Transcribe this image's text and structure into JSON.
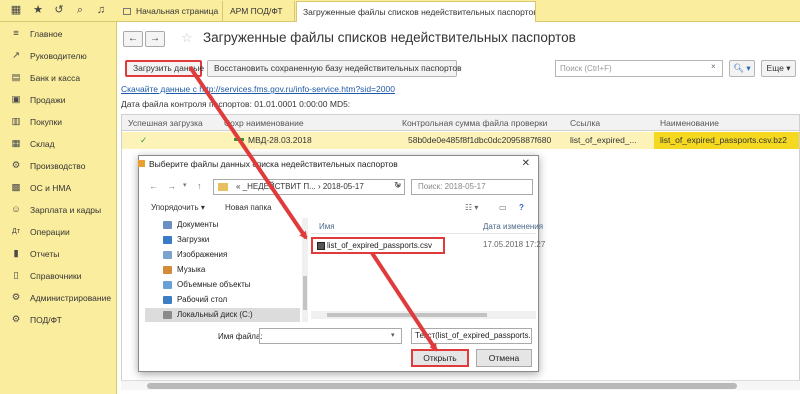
{
  "topbar": {
    "tabs": [
      {
        "label": "Начальная страница"
      },
      {
        "label": "АРМ ПОД/ФТ"
      },
      {
        "label": "Загруженные файлы списков недействительных паспортов",
        "close": "×"
      }
    ]
  },
  "sidebar": {
    "items": [
      {
        "label": "Главное",
        "icon": "menu-icon"
      },
      {
        "label": "Руководителю",
        "icon": "trend-icon"
      },
      {
        "label": "Банк и касса",
        "icon": "bank-icon"
      },
      {
        "label": "Продажи",
        "icon": "cart-icon"
      },
      {
        "label": "Покупки",
        "icon": "basket-icon"
      },
      {
        "label": "Склад",
        "icon": "warehouse-icon"
      },
      {
        "label": "Производство",
        "icon": "factory-icon"
      },
      {
        "label": "ОС и НМА",
        "icon": "assets-icon"
      },
      {
        "label": "Зарплата и кадры",
        "icon": "people-icon"
      },
      {
        "label": "Операции",
        "icon": "dt-kt-icon"
      },
      {
        "label": "Отчеты",
        "icon": "chart-icon"
      },
      {
        "label": "Справочники",
        "icon": "book-icon"
      },
      {
        "label": "Администрирование",
        "icon": "gear-icon"
      },
      {
        "label": "ПОД/ФТ",
        "icon": "gear-icon"
      }
    ]
  },
  "main": {
    "title": "Загруженные файлы списков недействительных паспортов",
    "load_button": "Загрузить данные",
    "restore_button": "Восстановить сохраненную базу недействительных паспортов",
    "search_placeholder": "Поиск (Ctrl+F)",
    "more_button": "Еще",
    "download_link": "Скачайте данные  с http://services.fms.gov.ru/info-service.htm?sid=2000",
    "date_info": "Дата файла контроля паспортов: 01.01.0001 0:00:00 MD5:",
    "columns": [
      "Успешная загрузка",
      "Сохр наименование",
      "Контрольная сумма файла проверки",
      "Ссылка",
      "Наименование"
    ],
    "rows": [
      {
        "success": "✓",
        "saved_name": "МВД-28.03.2018",
        "checksum": "58b0de0e485f8f1dbc0dc2095887f680",
        "link": "list_of_expired_...",
        "name": "list_of_expired_passports.csv.bz2"
      }
    ]
  },
  "dialog": {
    "title": "Выберите файлы данных списка недействительных паспортов",
    "address": "« _НЕДЕЙСТВИТ П...  ›  2018-05-17",
    "search_placeholder": "Поиск: 2018-05-17",
    "organize": "Упорядочить ▾",
    "new_folder": "Новая папка",
    "tree": [
      {
        "label": "Документы",
        "color": "#6a8fc0"
      },
      {
        "label": "Загрузки",
        "color": "#3a78c8"
      },
      {
        "label": "Изображения",
        "color": "#7aa3cf"
      },
      {
        "label": "Музыка",
        "color": "#d58a3a"
      },
      {
        "label": "Объемные объекты",
        "color": "#6aa0d8"
      },
      {
        "label": "Рабочий стол",
        "color": "#3c7dc4"
      },
      {
        "label": "Локальный диск (C:)",
        "color": "#8b8b8b"
      }
    ],
    "col_name": "Имя",
    "col_date": "Дата изменения",
    "file": {
      "name": "list_of_expired_passports.csv",
      "date": "17.05.2018 17:27"
    },
    "filename_label": "Имя файла:",
    "filename_value": "",
    "filetype": "Текст(list_of_expired_passports.",
    "open_button": "Открыть",
    "cancel_button": "Отмена"
  },
  "colors": {
    "accent_bar": "#fbed9e",
    "highlight_row": "#fdf3b8",
    "annotation": "#e03b3b",
    "link": "#1f5aa8"
  }
}
